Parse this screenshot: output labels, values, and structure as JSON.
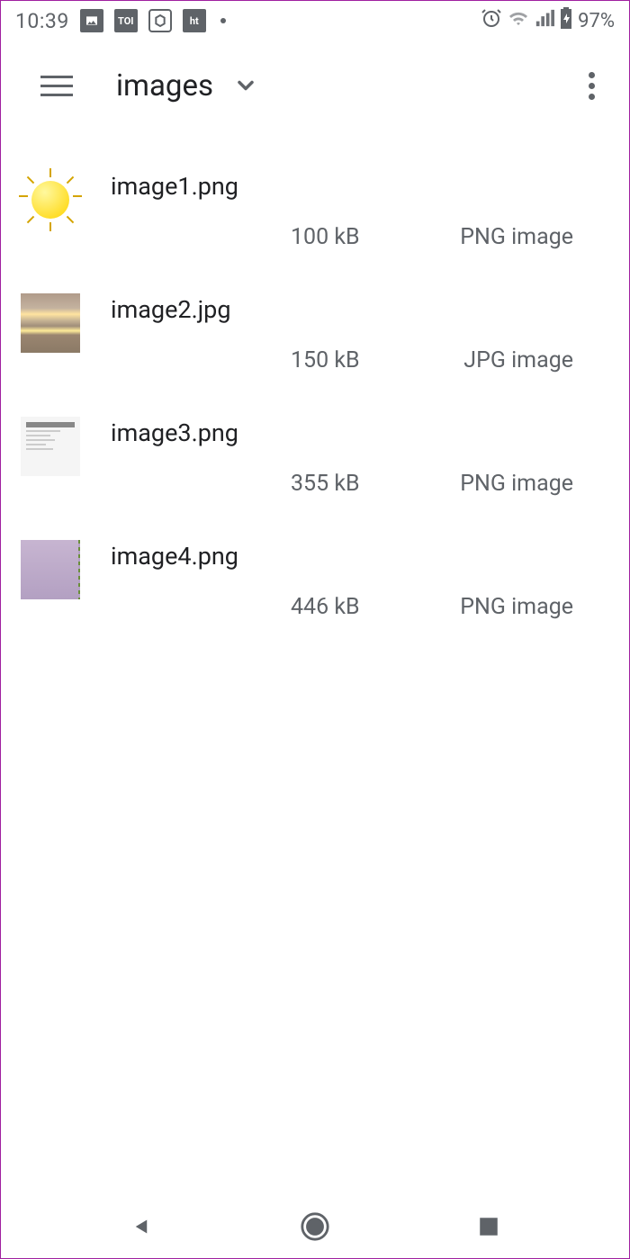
{
  "status_bar": {
    "time": "10:39",
    "battery": "97%"
  },
  "toolbar": {
    "folder_name": "images"
  },
  "files": [
    {
      "name": "image1.png",
      "size": "100 kB",
      "type": "PNG image"
    },
    {
      "name": "image2.jpg",
      "size": "150 kB",
      "type": "JPG image"
    },
    {
      "name": "image3.png",
      "size": "355 kB",
      "type": "PNG image"
    },
    {
      "name": "image4.png",
      "size": "446 kB",
      "type": "PNG image"
    }
  ]
}
